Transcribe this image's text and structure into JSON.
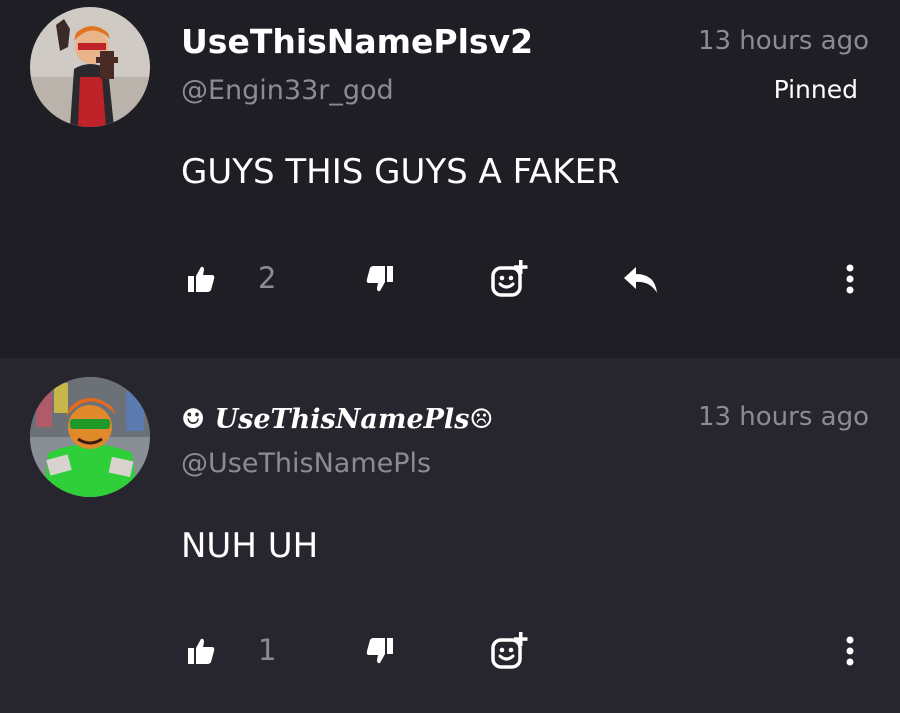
{
  "comments": [
    {
      "display_name": "UseThisNamePlsv2",
      "handle": "@Engin33r_god",
      "timestamp": "13 hours ago",
      "pinned_label": "Pinned",
      "text": "GUYS THIS GUYS A FAKER",
      "like_count": "2"
    },
    {
      "display_name": "☻ UseThisNamePls☹",
      "handle": "@UseThisNamePls",
      "timestamp": "13 hours ago",
      "text": "NUH UH",
      "like_count": "1"
    }
  ],
  "icons": {
    "like": "thumbs-up-icon",
    "dislike": "thumbs-down-icon",
    "react": "add-reaction-icon",
    "reply": "reply-arrow-icon",
    "more": "vertical-ellipsis-icon"
  }
}
